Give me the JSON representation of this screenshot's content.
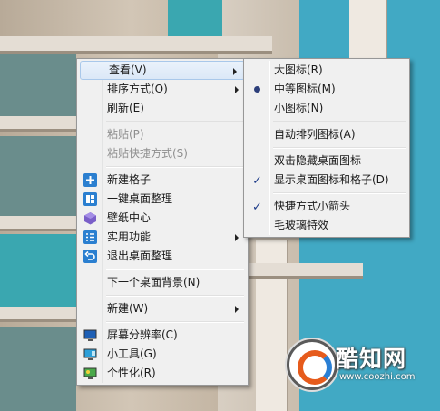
{
  "main_menu": {
    "view": "查看(V)",
    "sort": "排序方式(O)",
    "refresh": "刷新(E)",
    "paste": "粘贴(P)",
    "paste_shortcut": "粘贴快捷方式(S)",
    "new_grid": "新建格子",
    "one_click_organize": "一键桌面整理",
    "wallpaper_center": "壁纸中心",
    "utilities": "实用功能",
    "exit_organize": "退出桌面整理",
    "next_background": "下一个桌面背景(N)",
    "new": "新建(W)",
    "screen_resolution": "屏幕分辨率(C)",
    "gadgets": "小工具(G)",
    "personalize": "个性化(R)"
  },
  "view_submenu": {
    "large_icons": "大图标(R)",
    "medium_icons": "中等图标(M)",
    "small_icons": "小图标(N)",
    "auto_arrange": "自动排列图标(A)",
    "double_click_hide": "双击隐藏桌面图标",
    "show_icons_grids": "显示桌面图标和格子(D)",
    "shortcut_arrow": "快捷方式小箭头",
    "frosted_glass": "毛玻璃特效",
    "selected": "medium_icons",
    "checked": [
      "show_icons_grids",
      "shortcut_arrow"
    ]
  },
  "glyphs": {
    "check": "✓",
    "add": "+"
  },
  "colors": {
    "fences_blue": "#2b7fd0",
    "wallpaper_icon": "#7a5fc8",
    "hover_bg": "#dbe8f7",
    "disabled_text": "#8f8f8f"
  },
  "watermark": {
    "title": "酷知网",
    "url": "www.coozhi.com"
  }
}
